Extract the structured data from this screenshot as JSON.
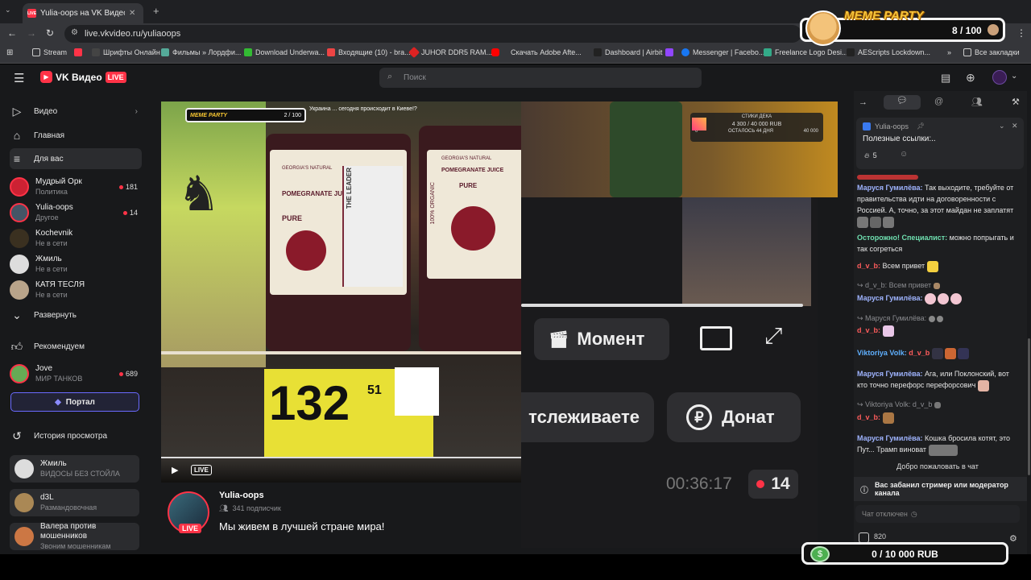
{
  "browser": {
    "tab_title": "Yulia-oops на VK Видео Live – .",
    "favicon_text": "LIVE",
    "url": "live.vkvideo.ru/yuliaoops",
    "bookmarks": [
      "Stream",
      "Шрифты Онлайн",
      "Фильмы » Лордфи...",
      "Download Underwa...",
      "Входящие (10) - bra...",
      "JUHOR DDR5 RAM...",
      "Скачать Adobe Afte...",
      "Dashboard | Airbit",
      "Messenger | Facebo...",
      "Freelance Logo Desi...",
      "AEScripts Lockdown..."
    ],
    "all_bookmarks": "Все закладки"
  },
  "overlay_top": {
    "title": "MEME PARTY",
    "count": "8 / 100"
  },
  "overlay_bottom": {
    "amount": "0 / 10 000 RUB"
  },
  "app": {
    "logo": "VK Видео",
    "live_badge": "LIVE",
    "search_placeholder": "Поиск"
  },
  "nav": {
    "video": "Видео",
    "home": "Главная",
    "for_you": "Для вас",
    "expand": "Развернуть",
    "recommended": "Рекомендуем",
    "portal": "Портал",
    "history": "История просмотра"
  },
  "subscriptions": [
    {
      "name": "Мудрый Орк",
      "sub": "Политика",
      "count": "181"
    },
    {
      "name": "Yulia-oops",
      "sub": "Другое",
      "count": "14"
    },
    {
      "name": "Kochevnik",
      "sub": "Не в сети",
      "count": ""
    },
    {
      "name": "Жмиль",
      "sub": "Не в сети",
      "count": ""
    },
    {
      "name": "КАТЯ ТЕСЛЯ",
      "sub": "Не в сети",
      "count": ""
    }
  ],
  "recommended": {
    "name": "Jove",
    "sub": "МИР ТАНКОВ",
    "count": "689"
  },
  "history": [
    {
      "name": "Жмиль",
      "sub": "ВИДОСЫ БЕЗ СТОЙЛА"
    },
    {
      "name": "d3L",
      "sub": "Размандовочная"
    },
    {
      "name": "Валера против мошенников",
      "sub": "Звоним мошенникам"
    }
  ],
  "player": {
    "live_label": "LIVE",
    "price_big": "132",
    "price_small": "51",
    "juice_label": "POMEGRANATE JUICE",
    "juice_brand": "GEORGIA'S NATURAL",
    "juice_pure": "PURE",
    "side_text": "THE LEADER",
    "organic": "100% ORGANIC",
    "inner_count": "2 / 100",
    "inner_goal": "4 300 / 40 000 RUB",
    "inner_goal_label": "СТИКИ ДЕКА",
    "inner_remain": "ОСТАЛОСЬ 44 ДНЯ",
    "inner_zero": "0",
    "inner_max": "40 000",
    "top_text": "Украина ... сегодня происходит в Киеве!?"
  },
  "background_ui": {
    "moment": "Момент",
    "following": "тслеживаете",
    "donate": "Донат",
    "timer": "00:36:17",
    "viewers": "14"
  },
  "channel": {
    "name": "Yulia-oops",
    "subscribers": "341 подписчик",
    "title": "Мы живем в лучшей стране мира!",
    "live": "LIVE"
  },
  "chat": {
    "pinned_author": "Yulia-oops",
    "pinned_text": "Полезные ссылки:..",
    "pinned_reactions": "5",
    "messages": [
      {
        "user": "Маруся Гумилёва:",
        "color": "#9fb4ff",
        "text": "Так выходите, требуйте от правительства идти на договоренности с Россией. А, точно, за этот майдан не заплатят"
      },
      {
        "user": "Осторожно! Специалист:",
        "color": "#6fe0b0",
        "text": "можно попрыгать и так согреться"
      },
      {
        "user": "d_v_b:",
        "color": "#ff5c5c",
        "text": "Всем привет"
      },
      {
        "user": "d_v_b: Всем привет",
        "color": "#8a8b8f",
        "text": ""
      },
      {
        "user": "Маруся Гумилёва:",
        "color": "#9fb4ff",
        "text": ""
      },
      {
        "user": "Маруся Гумилёва:",
        "color": "#8a8b8f",
        "text": ""
      },
      {
        "user": "d_v_b:",
        "color": "#ff5c5c",
        "text": ""
      },
      {
        "user": "Viktoriya Volk:",
        "color": "#5fb0ff",
        "text": "d_v_b"
      },
      {
        "user": "Маруся Гумилёва:",
        "color": "#9fb4ff",
        "text": "Ага, или Поклонский, вот кто точно перефорс перефорсович"
      },
      {
        "user": "Viktoriya Volk: d_v_b",
        "color": "#8a8b8f",
        "text": ""
      },
      {
        "user": "d_v_b:",
        "color": "#ff5c5c",
        "text": ""
      },
      {
        "user": "Маруся Гумилёва:",
        "color": "#9fb4ff",
        "text": "Кошка бросила котят, это Пут... Трамп виноват"
      }
    ],
    "welcome": "Добро пожаловать в чат",
    "banned": "Вас забанил стример или модератор канала",
    "disabled": "Чат отключен",
    "points": "820"
  }
}
